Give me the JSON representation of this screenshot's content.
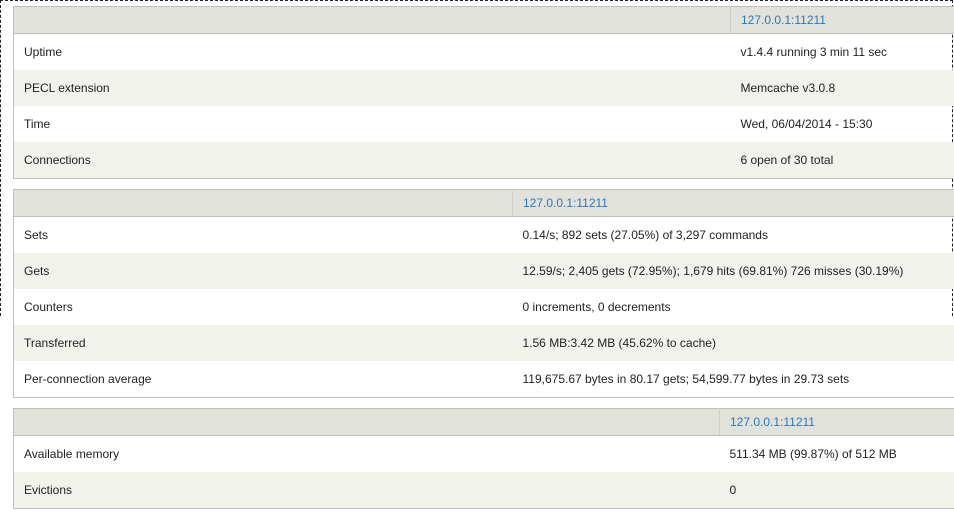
{
  "server": "127.0.0.1:11211",
  "general": {
    "rows": [
      {
        "label": "Uptime",
        "value": "v1.4.4 running 3 min 11 sec"
      },
      {
        "label": "PECL extension",
        "value": "Memcache v3.0.8"
      },
      {
        "label": "Time",
        "value": "Wed, 06/04/2014 - 15:30"
      },
      {
        "label": "Connections",
        "value": "6 open of 30 total"
      }
    ]
  },
  "stats": {
    "rows": [
      {
        "label": "Sets",
        "value": "0.14/s; 892 sets (27.05%) of 3,297 commands"
      },
      {
        "label": "Gets",
        "value": "12.59/s; 2,405 gets (72.95%); 1,679 hits (69.81%) 726 misses (30.19%)"
      },
      {
        "label": "Counters",
        "value": "0 increments, 0 decrements"
      },
      {
        "label": "Transferred",
        "value": "1.56 MB:3.42 MB (45.62% to cache)"
      },
      {
        "label": "Per-connection average",
        "value": "119,675.67 bytes in 80.17 gets; 54,599.77 bytes in 29.73 sets"
      }
    ]
  },
  "memory": {
    "rows": [
      {
        "label": "Available memory",
        "value": "511.34 MB (99.87%) of 512 MB"
      },
      {
        "label": "Evictions",
        "value": "0"
      }
    ]
  }
}
